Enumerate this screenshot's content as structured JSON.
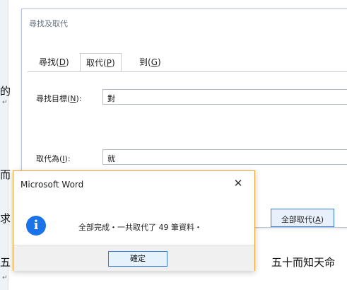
{
  "document": {
    "left_chars": [
      "的",
      "而",
      "῿"
    ],
    "char_1": "的",
    "char_2": "而",
    "char_3": "求",
    "char_4": "五",
    "right_text": "五十而知天命",
    "paragraph_mark": "↵"
  },
  "find_dialog": {
    "title": "尋找及取代",
    "tabs": [
      {
        "label": "尋找(",
        "key": "D",
        "suffix": ")"
      },
      {
        "label": "取代(",
        "key": "P",
        "suffix": ")"
      },
      {
        "label": "到(",
        "key": "G",
        "suffix": ")"
      }
    ],
    "find_label": "尋找目標(",
    "find_key": "N",
    "find_label_suffix": "):",
    "find_value": "對",
    "replace_label": "取代為(",
    "replace_key": "I",
    "replace_label_suffix": "):",
    "replace_value": "就",
    "replace_all_label": "全部取代(",
    "replace_all_key": "A",
    "replace_all_suffix": ")"
  },
  "message_box": {
    "title": "Microsoft Word",
    "close_glyph": "✕",
    "icon_glyph": "i",
    "message": "全部完成・一共取代了 49 筆資料・",
    "ok_label": "確定"
  }
}
